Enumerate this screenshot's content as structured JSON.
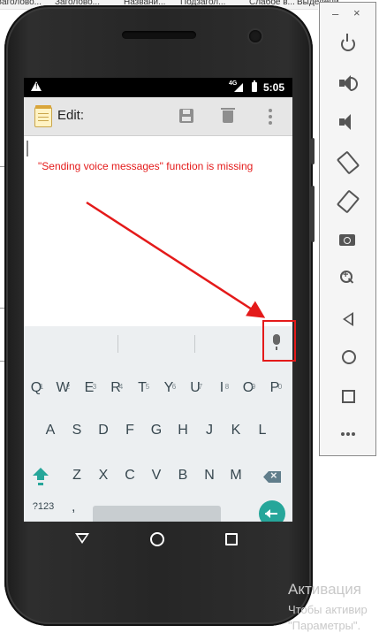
{
  "background_tabs": [
    "Заголово...",
    "Заголово...",
    "Названи...",
    "Подзагол...",
    "Слабое в...",
    "Выделени..."
  ],
  "status_bar": {
    "lte": "4G",
    "time": "5:05"
  },
  "action_bar": {
    "title": "Edit:"
  },
  "annotation": {
    "text": "\"Sending voice messages\" function is missing",
    "color": "#e41a1a"
  },
  "keyboard": {
    "row1": [
      "Q",
      "W",
      "E",
      "R",
      "T",
      "Y",
      "U",
      "I",
      "O",
      "P"
    ],
    "row1_hints": [
      "1",
      "2",
      "3",
      "4",
      "5",
      "6",
      "7",
      "8",
      "9",
      "0"
    ],
    "row2": [
      "A",
      "S",
      "D",
      "F",
      "G",
      "H",
      "J",
      "K",
      "L"
    ],
    "row3": [
      "Z",
      "X",
      "C",
      "V",
      "B",
      "N",
      "M"
    ],
    "symbols_label": "?123",
    "comma_label": ",",
    "accent_color": "#26a69a"
  },
  "emulator_panel": {
    "minimize": "–",
    "close": "×"
  },
  "watermark": {
    "line1": "Активация",
    "line2": "Чтобы активир",
    "line3": "\"Параметры\"."
  }
}
